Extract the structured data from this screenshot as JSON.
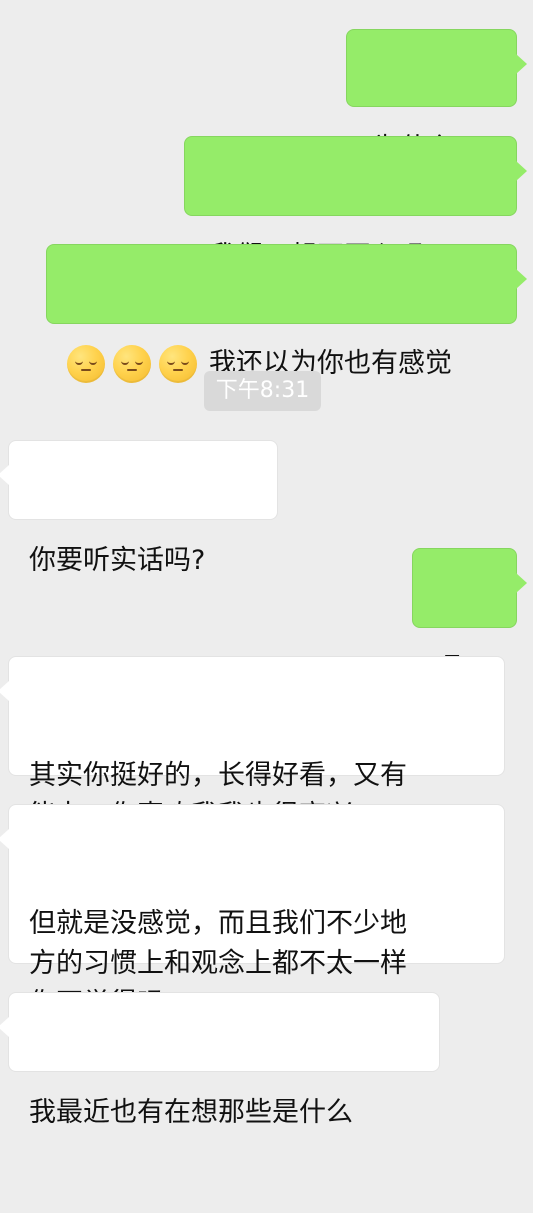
{
  "messages": {
    "m1": "为什么?",
    "m2": "我们一起不开心吗?",
    "m3": {
      "emoji_count": 3,
      "emoji_name": "pensive-face-icon",
      "text": "我还以为你也有感觉"
    },
    "time": "下午8:31",
    "m4": "你要听实话吗?",
    "m5": "嗯?",
    "m6": "其实你挺好的，长得好看，又有\n能力，你喜欢我我也很高兴。",
    "m7": "但就是没感觉，而且我们不少地\n方的习惯上和观念上都不太一样\n你不觉得吗",
    "m8": "我最近也有在想那些是什么"
  },
  "colors": {
    "background": "#ededed",
    "sent_bubble": "#95ec69",
    "received_bubble": "#ffffff",
    "time_pill": "#d9d9d9"
  }
}
